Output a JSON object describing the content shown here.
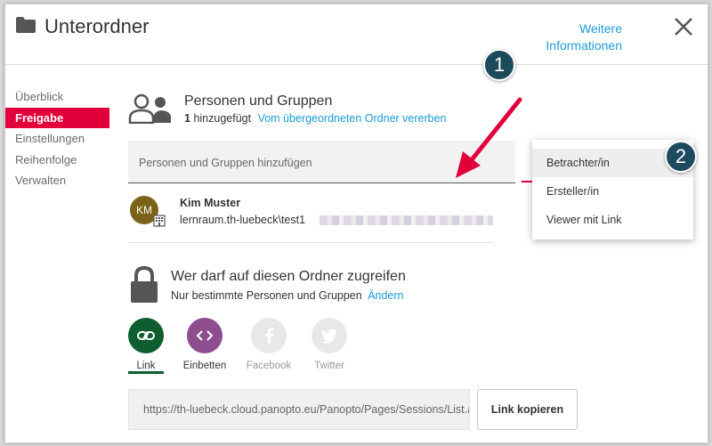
{
  "header": {
    "title": "Unterordner",
    "more_info": "Weitere Informationen",
    "close_icon": "close-icon",
    "folder_icon": "folder-icon"
  },
  "sidebar": {
    "items": [
      {
        "label": "Überblick",
        "active": false
      },
      {
        "label": "Freigabe",
        "active": true
      },
      {
        "label": "Einstellungen",
        "active": false
      },
      {
        "label": "Reihenfolge",
        "active": false
      },
      {
        "label": "Verwalten",
        "active": false
      }
    ]
  },
  "people": {
    "title": "Personen und Gruppen",
    "count": "1",
    "added_text": "hinzugefügt",
    "inherit_link": "Vom übergeordneten Ordner vererben",
    "search_placeholder": "Personen und Gruppen hinzufügen"
  },
  "user": {
    "initials": "KM",
    "name": "Kim Muster",
    "path": "lernraum.th-luebeck\\test1",
    "avatar_color": "#7a6319"
  },
  "access": {
    "title": "Wer darf auf diesen Ordner zugreifen",
    "subtitle": "Nur bestimmte Personen und Gruppen",
    "change_link": "Ändern"
  },
  "share_options": [
    {
      "label": "Link",
      "icon": "link-icon",
      "color": "#0f5e2f",
      "enabled": true
    },
    {
      "label": "Einbetten",
      "icon": "embed-icon",
      "color": "#8e4d8f",
      "enabled": true
    },
    {
      "label": "Facebook",
      "icon": "facebook-icon",
      "color": "#e8e8e8",
      "enabled": false
    },
    {
      "label": "Twitter",
      "icon": "twitter-icon",
      "color": "#e8e8e8",
      "enabled": false
    }
  ],
  "link": {
    "url": "https://th-luebeck.cloud.panopto.eu/Panopto/Pages/Sessions/List.aspx",
    "copy_label": "Link kopieren"
  },
  "role_menu": {
    "items": [
      "Betrachter/in",
      "Ersteller/in",
      "Viewer mit Link"
    ]
  },
  "callouts": {
    "one": "1",
    "two": "2"
  },
  "colors": {
    "accent": "#e2003b",
    "link": "#1a9bd7",
    "callout": "#1e4a5e"
  }
}
